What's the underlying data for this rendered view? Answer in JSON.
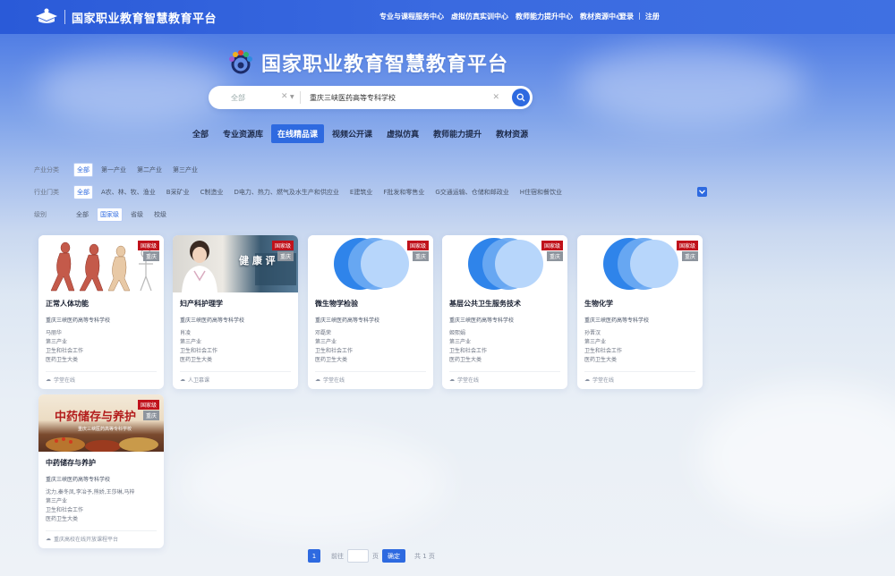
{
  "header": {
    "site_name": "国家职业教育智慧教育平台",
    "nav": [
      "专业与课程服务中心",
      "虚拟仿真实训中心",
      "教师能力提升中心",
      "教材资源中心"
    ],
    "login": "登录",
    "divider": "|",
    "register": "注册"
  },
  "hero": {
    "title": "国家职业教育智慧教育平台"
  },
  "search": {
    "scope_value": "全部",
    "query_value": "重庆三峡医药高等专科学校"
  },
  "tabs": [
    "全部",
    "专业资源库",
    "在线精品课",
    "视频公开课",
    "虚拟仿真",
    "教师能力提升",
    "教材资源"
  ],
  "active_tab": "在线精品课",
  "filters": {
    "industry_cat": {
      "label": "产业分类",
      "options": [
        "全部",
        "第一产业",
        "第二产业",
        "第三产业"
      ]
    },
    "industry": {
      "label": "行业门类",
      "options": [
        "全部",
        "A农、林、牧、渔业",
        "B采矿业",
        "C制造业",
        "D电力、热力、燃气及水生产和供应业",
        "E建筑业",
        "F批发和零售业",
        "G交通运输、仓储和邮政业",
        "H住宿和餐饮业"
      ]
    },
    "level": {
      "label": "级别",
      "options": [
        "全部",
        "国家级",
        "省级",
        "校级"
      ]
    }
  },
  "badges": {
    "national": "国家级",
    "cqdt": "重庆"
  },
  "courses": [
    {
      "title": "正常人体功能",
      "school": "重庆三峡医药高等专科学校",
      "teacher": "马丽华",
      "industry": "第三产业",
      "sector": "卫生和社会工作",
      "category": "医药卫生大类",
      "platform": "学堂在线"
    },
    {
      "title": "妇产科护理学",
      "school": "重庆三峡医药高等专科学校",
      "teacher": "肖凌",
      "industry": "第三产业",
      "sector": "卫生和社会工作",
      "category": "医药卫生大类",
      "platform": "人卫慕课"
    },
    {
      "title": "微生物学检验",
      "school": "重庆三峡医药高等专科学校",
      "teacher": "邓磊荣",
      "industry": "第三产业",
      "sector": "卫生和社会工作",
      "category": "医药卫生大类",
      "platform": "学堂在线"
    },
    {
      "title": "基层公共卫生服务技术",
      "school": "重庆三峡医药高等专科学校",
      "teacher": "姬熙娟",
      "industry": "第三产业",
      "sector": "卫生和社会工作",
      "category": "医药卫生大类",
      "platform": "学堂在线"
    },
    {
      "title": "生物化学",
      "school": "重庆三峡医药高等专科学校",
      "teacher": "孙晋汉",
      "industry": "第三产业",
      "sector": "卫生和社会工作",
      "category": "医药卫生大类",
      "platform": "学堂在线"
    },
    {
      "title": "中药储存与养护",
      "school": "重庆三峡医药高等专科学校",
      "teacher": "沈力,秦冬凤,李冶予,熊娇,王莎琳,马梓",
      "industry": "第三产业",
      "sector": "卫生和社会工作",
      "category": "医药卫生大类",
      "platform": "重庆高校在线开放课程平台"
    }
  ],
  "course1_image_text": "健 康 评 ",
  "course6_image_text": "中药储存与养护",
  "course6_image_sub": "重庆三峡医药高等专科学校",
  "pagination": {
    "current": "1",
    "goto_prefix": "前往",
    "goto_suffix": "页",
    "confirm": "确定",
    "total": "共 1 页"
  },
  "colors": {
    "primary": "#2e6ae0",
    "national_badge": "#c0121b",
    "topbar": "#2a5ad8"
  }
}
